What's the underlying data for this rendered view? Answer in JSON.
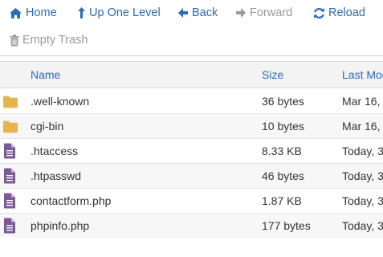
{
  "toolbar": {
    "home_label": "Home",
    "up_label": "Up One Level",
    "back_label": "Back",
    "forward_label": "Forward",
    "reload_label": "Reload",
    "empty_trash_label": "Empty Trash"
  },
  "columns": {
    "name": "Name",
    "size": "Size",
    "modified": "Last Mod"
  },
  "files": [
    {
      "icon": "folder-icon",
      "name": ".well-known",
      "size": "36 bytes",
      "modified": "Mar 16,"
    },
    {
      "icon": "folder-icon",
      "name": "cgi-bin",
      "size": "10 bytes",
      "modified": "Mar 16,"
    },
    {
      "icon": "file-icon",
      "name": ".htaccess",
      "size": "8.33 KB",
      "modified": "Today, 3"
    },
    {
      "icon": "file-icon",
      "name": ".htpasswd",
      "size": "46 bytes",
      "modified": "Today, 3"
    },
    {
      "icon": "file-icon",
      "name": "contactform.php",
      "size": "1.87 KB",
      "modified": "Today, 3"
    },
    {
      "icon": "file-icon",
      "name": "phpinfo.php",
      "size": "177 bytes",
      "modified": "Today, 3"
    }
  ],
  "colors": {
    "link": "#2a6ab8",
    "disabled": "#999999",
    "folder": "#e8b34a",
    "file": "#7b5a96"
  }
}
